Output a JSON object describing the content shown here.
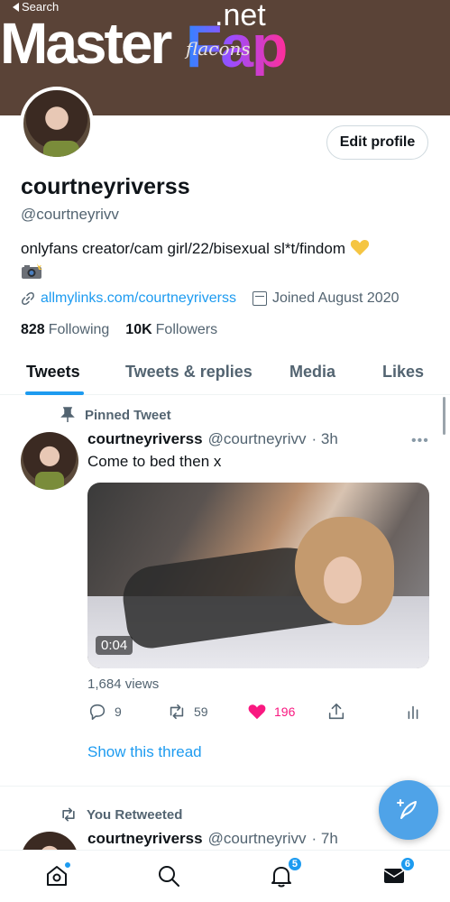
{
  "nav": {
    "back_label": "Search"
  },
  "watermark": {
    "master": "Master",
    "fap": "Fap",
    "net": ".net",
    "subtitle": "flacons"
  },
  "profile": {
    "edit_button": "Edit profile",
    "display_name": "courtneyriverss",
    "handle": "@courtneyrivv",
    "bio": "onlyfans creator/cam girl/22/bisexual sl*t/findom",
    "link": "allmylinks.com/courtneyriverss",
    "joined": "Joined August 2020",
    "following_count": "828",
    "following_label": "Following",
    "followers_count": "10K",
    "followers_label": "Followers"
  },
  "tabs": [
    {
      "label": "Tweets",
      "active": true
    },
    {
      "label": "Tweets & replies",
      "active": false
    },
    {
      "label": "Media",
      "active": false
    },
    {
      "label": "Likes",
      "active": false
    }
  ],
  "tweet1": {
    "context": "Pinned Tweet",
    "name": "courtneyriverss",
    "handle": "@courtneyrivv",
    "time": "· 3h",
    "text": "Come to bed then x",
    "video_duration": "0:04",
    "views": "1,684 views",
    "replies": "9",
    "retweets": "59",
    "likes": "196",
    "show_thread": "Show this thread"
  },
  "tweet2": {
    "context": "You Retweeted",
    "name": "courtneyriverss",
    "handle": "@courtneyrivv",
    "time": "· 7h"
  },
  "bottom_nav": {
    "notifications_badge": "5",
    "messages_badge": "6"
  },
  "colors": {
    "accent": "#1d9bf0",
    "like": "#f91880",
    "banner": "#5a4337"
  },
  "icons": [
    "back-arrow-icon",
    "link-icon",
    "calendar-icon",
    "pin-icon",
    "more-icon",
    "reply-icon",
    "retweet-icon",
    "heart-icon",
    "share-icon",
    "analytics-icon",
    "compose-icon",
    "home-icon",
    "search-icon",
    "bell-icon",
    "mail-icon"
  ]
}
